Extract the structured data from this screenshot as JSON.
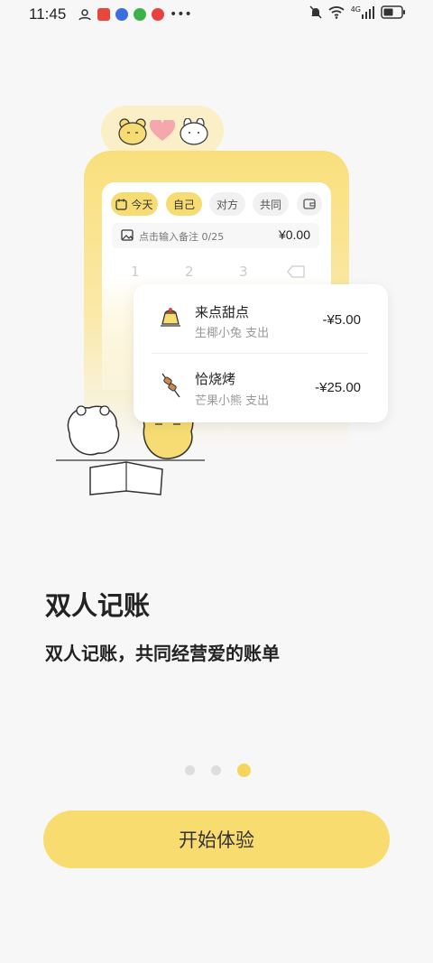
{
  "status_bar": {
    "time": "11:45",
    "network_label": "4G",
    "colors": {
      "app1": "#e6483d",
      "app2": "#3b6fe0",
      "app3": "#3cb34a",
      "app4": "#e94141"
    }
  },
  "illustration": {
    "tabs": [
      {
        "label": "今天",
        "active": true
      },
      {
        "label": "自己",
        "active": true
      },
      {
        "label": "对方",
        "active": false
      },
      {
        "label": "共同",
        "active": false
      }
    ],
    "note_placeholder": "点击输入备注 0/25",
    "amount": "¥0.00",
    "keypad": [
      "1",
      "2",
      "3"
    ],
    "transactions": [
      {
        "title": "来点甜点",
        "subtitle": "生椰小兔 支出",
        "amount": "-¥5.00",
        "icon": "pudding-icon"
      },
      {
        "title": "恰烧烤",
        "subtitle": "芒果小熊 支出",
        "amount": "-¥25.00",
        "icon": "skewer-icon"
      }
    ]
  },
  "onboarding": {
    "title": "双人记账",
    "subtitle": "双人记账，共同经营爱的账单",
    "page_index": 3,
    "page_count": 3
  },
  "cta": {
    "label": "开始体验"
  },
  "colors": {
    "accent": "#f9dc70",
    "card_bg": "#ffffff",
    "bg": "#f7f7f7"
  }
}
